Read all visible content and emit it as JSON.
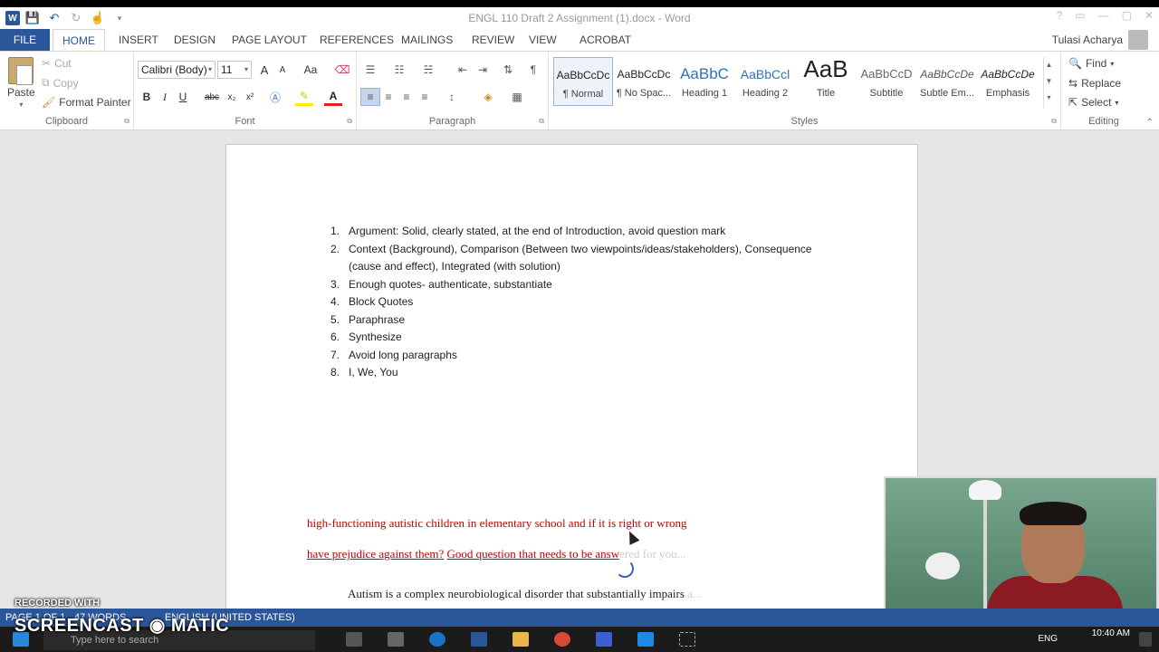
{
  "titlebar": {
    "title": "ENGL 110 Draft 2 Assignment (1).docx - Word",
    "icons": [
      "word-logo",
      "save-icon",
      "undo-icon",
      "redo-icon",
      "touch-mode-icon",
      "customize-icon"
    ],
    "controls": [
      "?",
      "▭",
      "—",
      "▢",
      "✕"
    ]
  },
  "tabs": {
    "file": "FILE",
    "home": "HOME",
    "insert": "INSERT",
    "design": "DESIGN",
    "page_layout": "PAGE LAYOUT",
    "references": "REFERENCES",
    "mailings": "MAILINGS",
    "review": "REVIEW",
    "view": "VIEW",
    "acrobat": "ACROBAT",
    "user": "Tulasi Acharya"
  },
  "clipboard": {
    "paste": "Paste",
    "cut": "Cut",
    "copy": "Copy",
    "format_painter": "Format Painter",
    "label": "Clipboard"
  },
  "font": {
    "name": "Calibri (Body)",
    "size": "11",
    "label": "Font",
    "bold": "B",
    "italic": "I",
    "underline": "U",
    "strike": "abc",
    "sub": "x₂",
    "sup": "x²",
    "grow": "A",
    "shrink": "A",
    "case": "Aa"
  },
  "paragraph": {
    "label": "Paragraph",
    "pilcrow": "¶"
  },
  "styles": {
    "label": "Styles",
    "items": [
      {
        "sample": "AaBbCcDc",
        "name": "¶ Normal"
      },
      {
        "sample": "AaBbCcDc",
        "name": "¶ No Spac..."
      },
      {
        "sample": "AaBbC",
        "name": "Heading 1"
      },
      {
        "sample": "AaBbCcl",
        "name": "Heading 2"
      },
      {
        "sample": "AaB",
        "name": "Title"
      },
      {
        "sample": "AaBbCcD",
        "name": "Subtitle"
      },
      {
        "sample": "AaBbCcDe",
        "name": "Subtle Em..."
      },
      {
        "sample": "AaBbCcDe",
        "name": "Emphasis"
      }
    ]
  },
  "editing": {
    "find": "Find",
    "replace": "Replace",
    "select": "Select",
    "label": "Editing"
  },
  "document": {
    "list": [
      {
        "num": "1.",
        "text": "Argument: Solid, clearly stated, at the end of Introduction, avoid question mark"
      },
      {
        "num": "2.",
        "text": "Context (Background), Comparison (Between two viewpoints/ideas/stakeholders), Consequence (cause and effect), Integrated (with solution)"
      },
      {
        "num": "3.",
        "text": "Enough quotes- authenticate, substantiate"
      },
      {
        "num": "4.",
        "text": "Block Quotes"
      },
      {
        "num": "5.",
        "text": "Paraphrase"
      },
      {
        "num": "6.",
        "text": "Synthesize"
      },
      {
        "num": "7.",
        "text": "Avoid long paragraphs"
      },
      {
        "num": "8.",
        "text": "I, We, You"
      }
    ],
    "red_line_1": "high-functioning autistic children in elementary school and if it is right or wrong",
    "red_line_2_a": "have prejudice against them?",
    "red_line_2_b": "Good question that needs to be answ",
    "red_line_2_c": "ered for you...",
    "body_line": "Autism is a complex neurobiological disorder that substantially impairs",
    "body_line_fade": "a..."
  },
  "statusbar": {
    "page": "PAGE 1 OF 1",
    "words": "47 WORDS",
    "language": "ENGLISH (UNITED STATES)"
  },
  "taskbar": {
    "search": "Type here to search",
    "lang": "ENG",
    "time": "10:40 AM"
  },
  "watermark": {
    "line1": "RECORDED WITH",
    "line2": "SCREENCAST ◉ MATIC"
  }
}
